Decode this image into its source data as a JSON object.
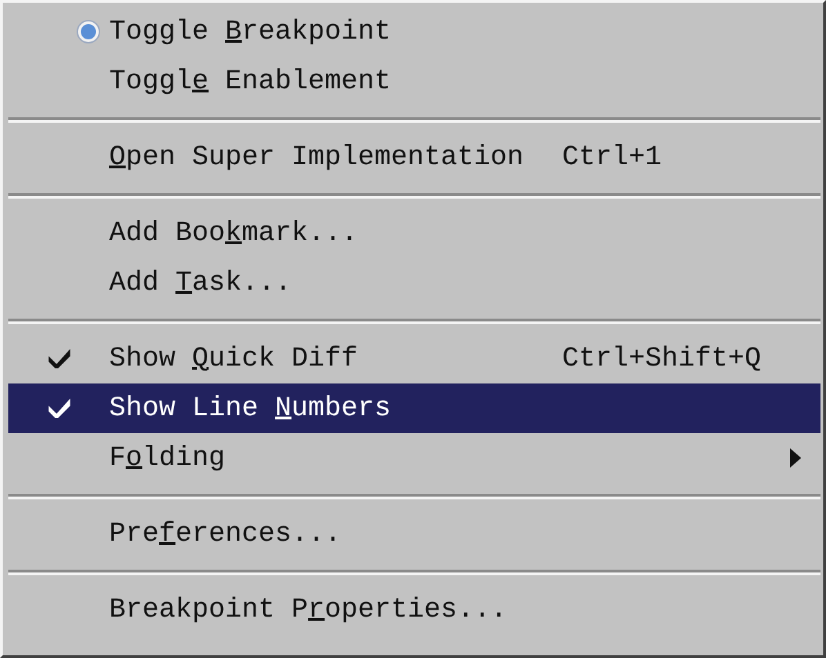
{
  "menu": {
    "items": [
      {
        "kind": "radio",
        "label": [
          {
            "text": "Toggle ",
            "underlined": false
          },
          {
            "text": "B",
            "underlined": true
          },
          {
            "text": "reakpoint",
            "underlined": false
          }
        ],
        "checked": true,
        "selected": false
      },
      {
        "kind": "plain",
        "label": [
          {
            "text": "Toggl",
            "underlined": false
          },
          {
            "text": "e",
            "underlined": true
          },
          {
            "text": " Enablement",
            "underlined": false
          }
        ],
        "selected": false
      },
      {
        "kind": "separator"
      },
      {
        "kind": "plain",
        "label": [
          {
            "text": "O",
            "underlined": true
          },
          {
            "text": "pen Super Implementation",
            "underlined": false
          }
        ],
        "shortcut": "Ctrl+1",
        "selected": false
      },
      {
        "kind": "separator"
      },
      {
        "kind": "plain",
        "label": [
          {
            "text": "Add Boo",
            "underlined": false
          },
          {
            "text": "k",
            "underlined": true
          },
          {
            "text": "mark...",
            "underlined": false
          }
        ],
        "selected": false
      },
      {
        "kind": "plain",
        "label": [
          {
            "text": "Add ",
            "underlined": false
          },
          {
            "text": "T",
            "underlined": true
          },
          {
            "text": "ask...",
            "underlined": false
          }
        ],
        "selected": false
      },
      {
        "kind": "separator"
      },
      {
        "kind": "check",
        "label": [
          {
            "text": "Show ",
            "underlined": false
          },
          {
            "text": "Q",
            "underlined": true
          },
          {
            "text": "uick Diff",
            "underlined": false
          }
        ],
        "shortcut": "Ctrl+Shift+Q",
        "checked": true,
        "selected": false
      },
      {
        "kind": "check",
        "label": [
          {
            "text": "Show Line ",
            "underlined": false
          },
          {
            "text": "N",
            "underlined": true
          },
          {
            "text": "umbers",
            "underlined": false
          }
        ],
        "checked": true,
        "selected": true
      },
      {
        "kind": "submenu",
        "label": [
          {
            "text": "F",
            "underlined": false
          },
          {
            "text": "o",
            "underlined": true
          },
          {
            "text": "lding",
            "underlined": false
          }
        ],
        "selected": false
      },
      {
        "kind": "separator"
      },
      {
        "kind": "plain",
        "label": [
          {
            "text": "Pre",
            "underlined": false
          },
          {
            "text": "f",
            "underlined": true
          },
          {
            "text": "erences...",
            "underlined": false
          }
        ],
        "selected": false
      },
      {
        "kind": "separator"
      },
      {
        "kind": "plain",
        "label": [
          {
            "text": "Breakpoint P",
            "underlined": false
          },
          {
            "text": "r",
            "underlined": true
          },
          {
            "text": "operties...",
            "underlined": false
          }
        ],
        "selected": false
      }
    ]
  }
}
